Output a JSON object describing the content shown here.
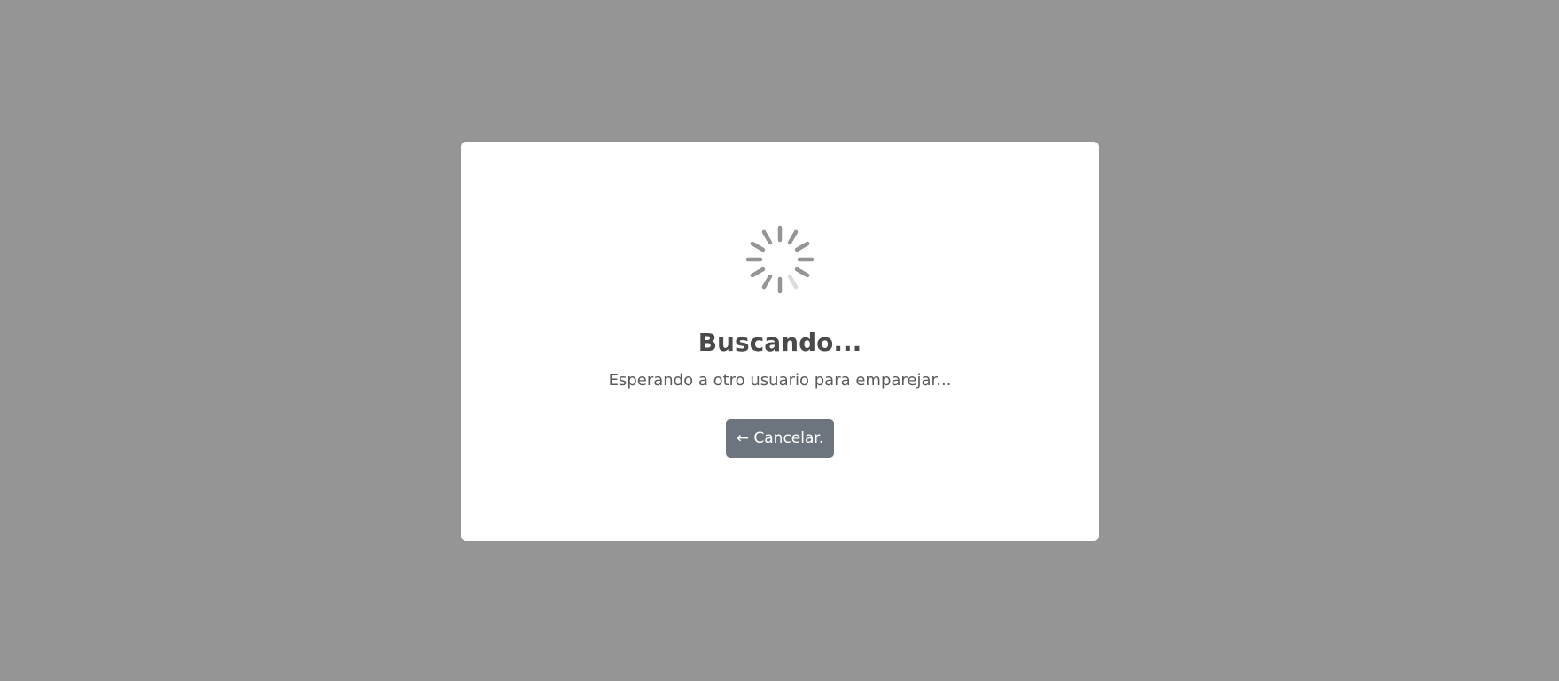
{
  "modal": {
    "title": "Buscando...",
    "subtitle": "Esperando a otro usuario para emparejar...",
    "cancel_label": "← Cancelar."
  },
  "spinner": {
    "icon": "loading-spinner-icon",
    "color": "#959595"
  },
  "colors": {
    "overlay": "#959595",
    "modal_bg": "#ffffff",
    "button_bg": "#6c757d",
    "title_text": "#4a4a4a"
  }
}
